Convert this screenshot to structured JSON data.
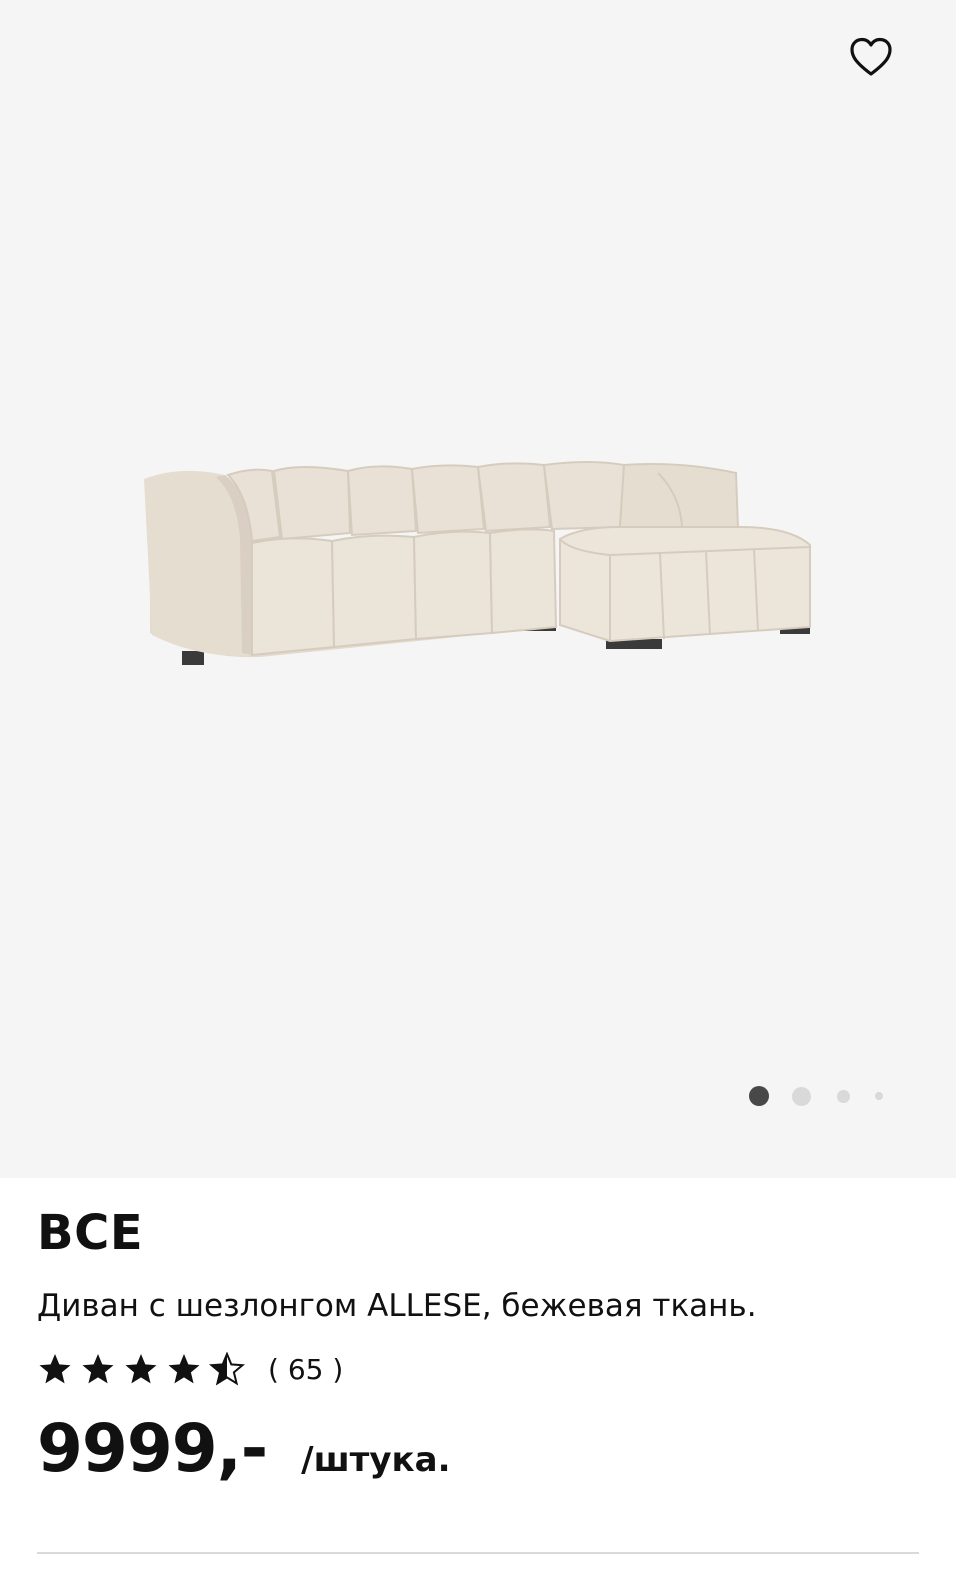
{
  "gallery": {
    "image_alt": "sofa-with-chaise-image",
    "carousel": {
      "total_indicators": 4,
      "active_index": 0
    }
  },
  "product": {
    "brand": "ВСЕ",
    "description": "Диван с шезлонгом ALLESE, бежевая ткань.",
    "rating": {
      "value": 4.5,
      "max": 5,
      "count_label": "( 65 )"
    },
    "price": "9999,-",
    "price_unit": "/штука."
  },
  "icons": {
    "favorite": "heart-outline-icon",
    "star_filled": "star-filled-icon",
    "star_half": "star-half-icon",
    "star_empty": "star-outline-icon"
  },
  "colors": {
    "gallery_bg": "#f5f5f5",
    "text": "#111111",
    "active_dot": "#484848",
    "inactive_dot": "#d9d9d9",
    "sofa_fabric": "#e9e1d6",
    "divider": "#d9d9d9"
  }
}
